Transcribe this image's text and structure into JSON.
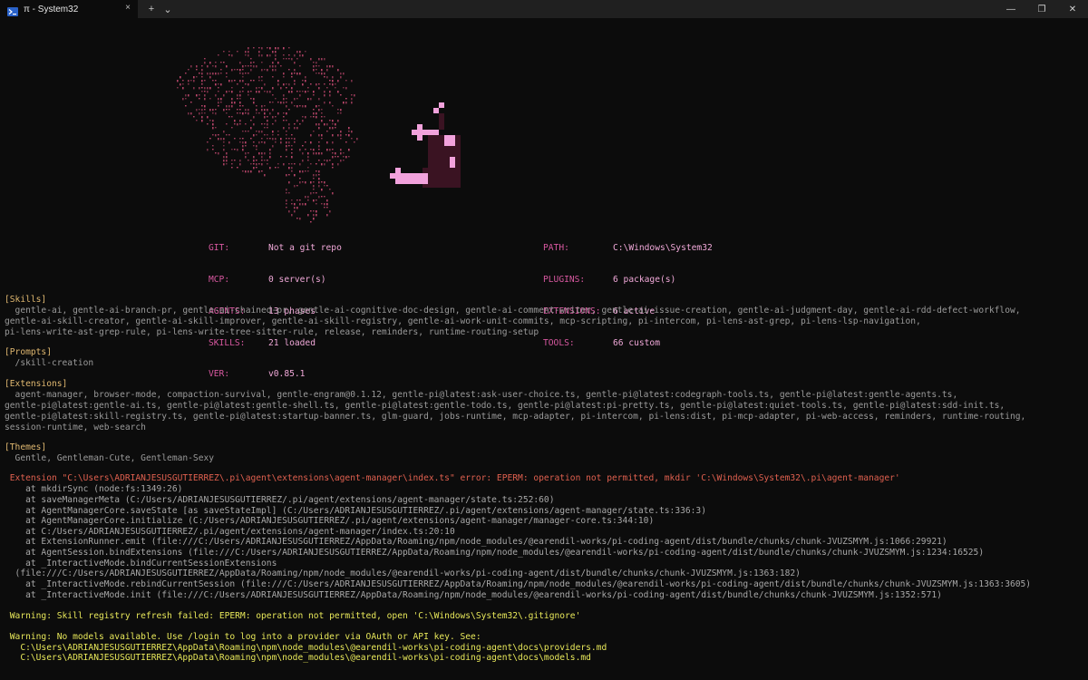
{
  "window": {
    "tab_title": "π - System32",
    "tab_close": "×",
    "new_tab": "+",
    "dropdown": "⌄",
    "minimize": "—",
    "maximize": "❐",
    "close": "✕"
  },
  "icons": {
    "tab_icon": "terminal-icon",
    "ascii_art": "brain-ascii-art",
    "logo": "pi-pixel-logo"
  },
  "info": {
    "left": [
      {
        "key": "GIT:",
        "value": "Not a git repo"
      },
      {
        "key": "MCP:",
        "value": "0 server(s)"
      },
      {
        "key": "AGENTS:",
        "value": "13 phases"
      },
      {
        "key": "SKILLS:",
        "value": "21 loaded"
      },
      {
        "key": "VER:",
        "value": "v0.85.1"
      }
    ],
    "right": [
      {
        "key": "PATH:",
        "value": "C:\\Windows\\System32"
      },
      {
        "key": "PLUGINS:",
        "value": "6 package(s)"
      },
      {
        "key": "EXTENSIONS:",
        "value": "6 active"
      },
      {
        "key": "TOOLS:",
        "value": "66 custom"
      }
    ]
  },
  "sections": {
    "skills_header": "[Skills]",
    "skills_lines": [
      "  gentle-ai, gentle-ai-branch-pr, gentle-ai-chained-pr, gentle-ai-cognitive-doc-design, gentle-ai-comment-writer, gentle-ai-issue-creation, gentle-ai-judgment-day, gentle-ai-rdd-defect-workflow,",
      "gentle-ai-skill-creator, gentle-ai-skill-improver, gentle-ai-skill-registry, gentle-ai-work-unit-commits, mcp-scripting, pi-intercom, pi-lens-ast-grep, pi-lens-lsp-navigation,",
      "pi-lens-write-ast-grep-rule, pi-lens-write-tree-sitter-rule, release, reminders, runtime-routing-setup"
    ],
    "prompts_header": "[Prompts]",
    "prompts_lines": [
      "  /skill-creation"
    ],
    "extensions_header": "[Extensions]",
    "extensions_lines": [
      "  agent-manager, browser-mode, compaction-survival, gentle-engram@0.1.12, gentle-pi@latest:ask-user-choice.ts, gentle-pi@latest:codegraph-tools.ts, gentle-pi@latest:gentle-agents.ts,",
      "gentle-pi@latest:gentle-ai.ts, gentle-pi@latest:gentle-shell.ts, gentle-pi@latest:gentle-todo.ts, gentle-pi@latest:pi-pretty.ts, gentle-pi@latest:quiet-tools.ts, gentle-pi@latest:sdd-init.ts,",
      "gentle-pi@latest:skill-registry.ts, gentle-pi@latest:startup-banner.ts, glm-guard, jobs-runtime, mcp-adapter, pi-intercom, pi-lens:dist, pi-mcp-adapter, pi-web-access, reminders, runtime-routing,",
      "session-runtime, web-search"
    ],
    "themes_header": "[Themes]",
    "themes_lines": [
      "  Gentle, Gentleman-Cute, Gentleman-Sexy"
    ]
  },
  "error": {
    "message": " Extension \"C:\\Users\\ADRIANJESUSGUTIERREZ\\.pi\\agent\\extensions\\agent-manager\\index.ts\" error: EPERM: operation not permitted, mkdir 'C:\\Windows\\System32\\.pi\\agent-manager'",
    "stack": [
      "    at mkdirSync (node:fs:1349:26)",
      "    at saveManagerMeta (C:/Users/ADRIANJESUSGUTIERREZ/.pi/agent/extensions/agent-manager/state.ts:252:60)",
      "    at AgentManagerCore.saveState [as saveStateImpl] (C:/Users/ADRIANJESUSGUTIERREZ/.pi/agent/extensions/agent-manager/state.ts:336:3)",
      "    at AgentManagerCore.initialize (C:/Users/ADRIANJESUSGUTIERREZ/.pi/agent/extensions/agent-manager/manager-core.ts:344:10)",
      "    at C:/Users/ADRIANJESUSGUTIERREZ/.pi/agent/extensions/agent-manager/index.ts:20:10",
      "    at ExtensionRunner.emit (file:///C:/Users/ADRIANJESUSGUTIERREZ/AppData/Roaming/npm/node_modules/@earendil-works/pi-coding-agent/dist/bundle/chunks/chunk-JVUZSMYM.js:1066:29921)",
      "    at AgentSession.bindExtensions (file:///C:/Users/ADRIANJESUSGUTIERREZ/AppData/Roaming/npm/node_modules/@earendil-works/pi-coding-agent/dist/bundle/chunks/chunk-JVUZSMYM.js:1234:16525)",
      "    at _InteractiveMode.bindCurrentSessionExtensions",
      "  (file:///C:/Users/ADRIANJESUSGUTIERREZ/AppData/Roaming/npm/node_modules/@earendil-works/pi-coding-agent/dist/bundle/chunks/chunk-JVUZSMYM.js:1363:182)",
      "    at _InteractiveMode.rebindCurrentSession (file:///C:/Users/ADRIANJESUSGUTIERREZ/AppData/Roaming/npm/node_modules/@earendil-works/pi-coding-agent/dist/bundle/chunks/chunk-JVUZSMYM.js:1363:3605)",
      "    at _InteractiveMode.init (file:///C:/Users/ADRIANJESUSGUTIERREZ/AppData/Roaming/npm/node_modules/@earendil-works/pi-coding-agent/dist/bundle/chunks/chunk-JVUZSMYM.js:1352:571)"
    ]
  },
  "warnings": {
    "skill_registry": " Warning: Skill registry refresh failed: EPERM: operation not permitted, open 'C:\\Windows\\System32\\.gitignore'",
    "no_models": " Warning: No models available. Use /login to log into a provider via OAuth or API key. See:",
    "providers_doc": "   C:\\Users\\ADRIANJESUSGUTIERREZ\\AppData\\Roaming\\npm\\node_modules\\@earendil-works\\pi-coding-agent\\docs\\providers.md",
    "models_doc": "   C:\\Users\\ADRIANJESUSGUTIERREZ\\AppData\\Roaming\\npm\\node_modules\\@earendil-works\\pi-coding-agent\\docs\\models.md"
  },
  "colors": {
    "background": "#0c0c0c",
    "section_header": "#e0b870",
    "error": "#e0604f",
    "warning": "#e8e85a",
    "info_key": "#d858a0",
    "info_value": "#f0a8d8",
    "logo_pink": "#f2a2dc",
    "logo_dark": "#3a1322",
    "ascii_art": "#c0486e"
  }
}
